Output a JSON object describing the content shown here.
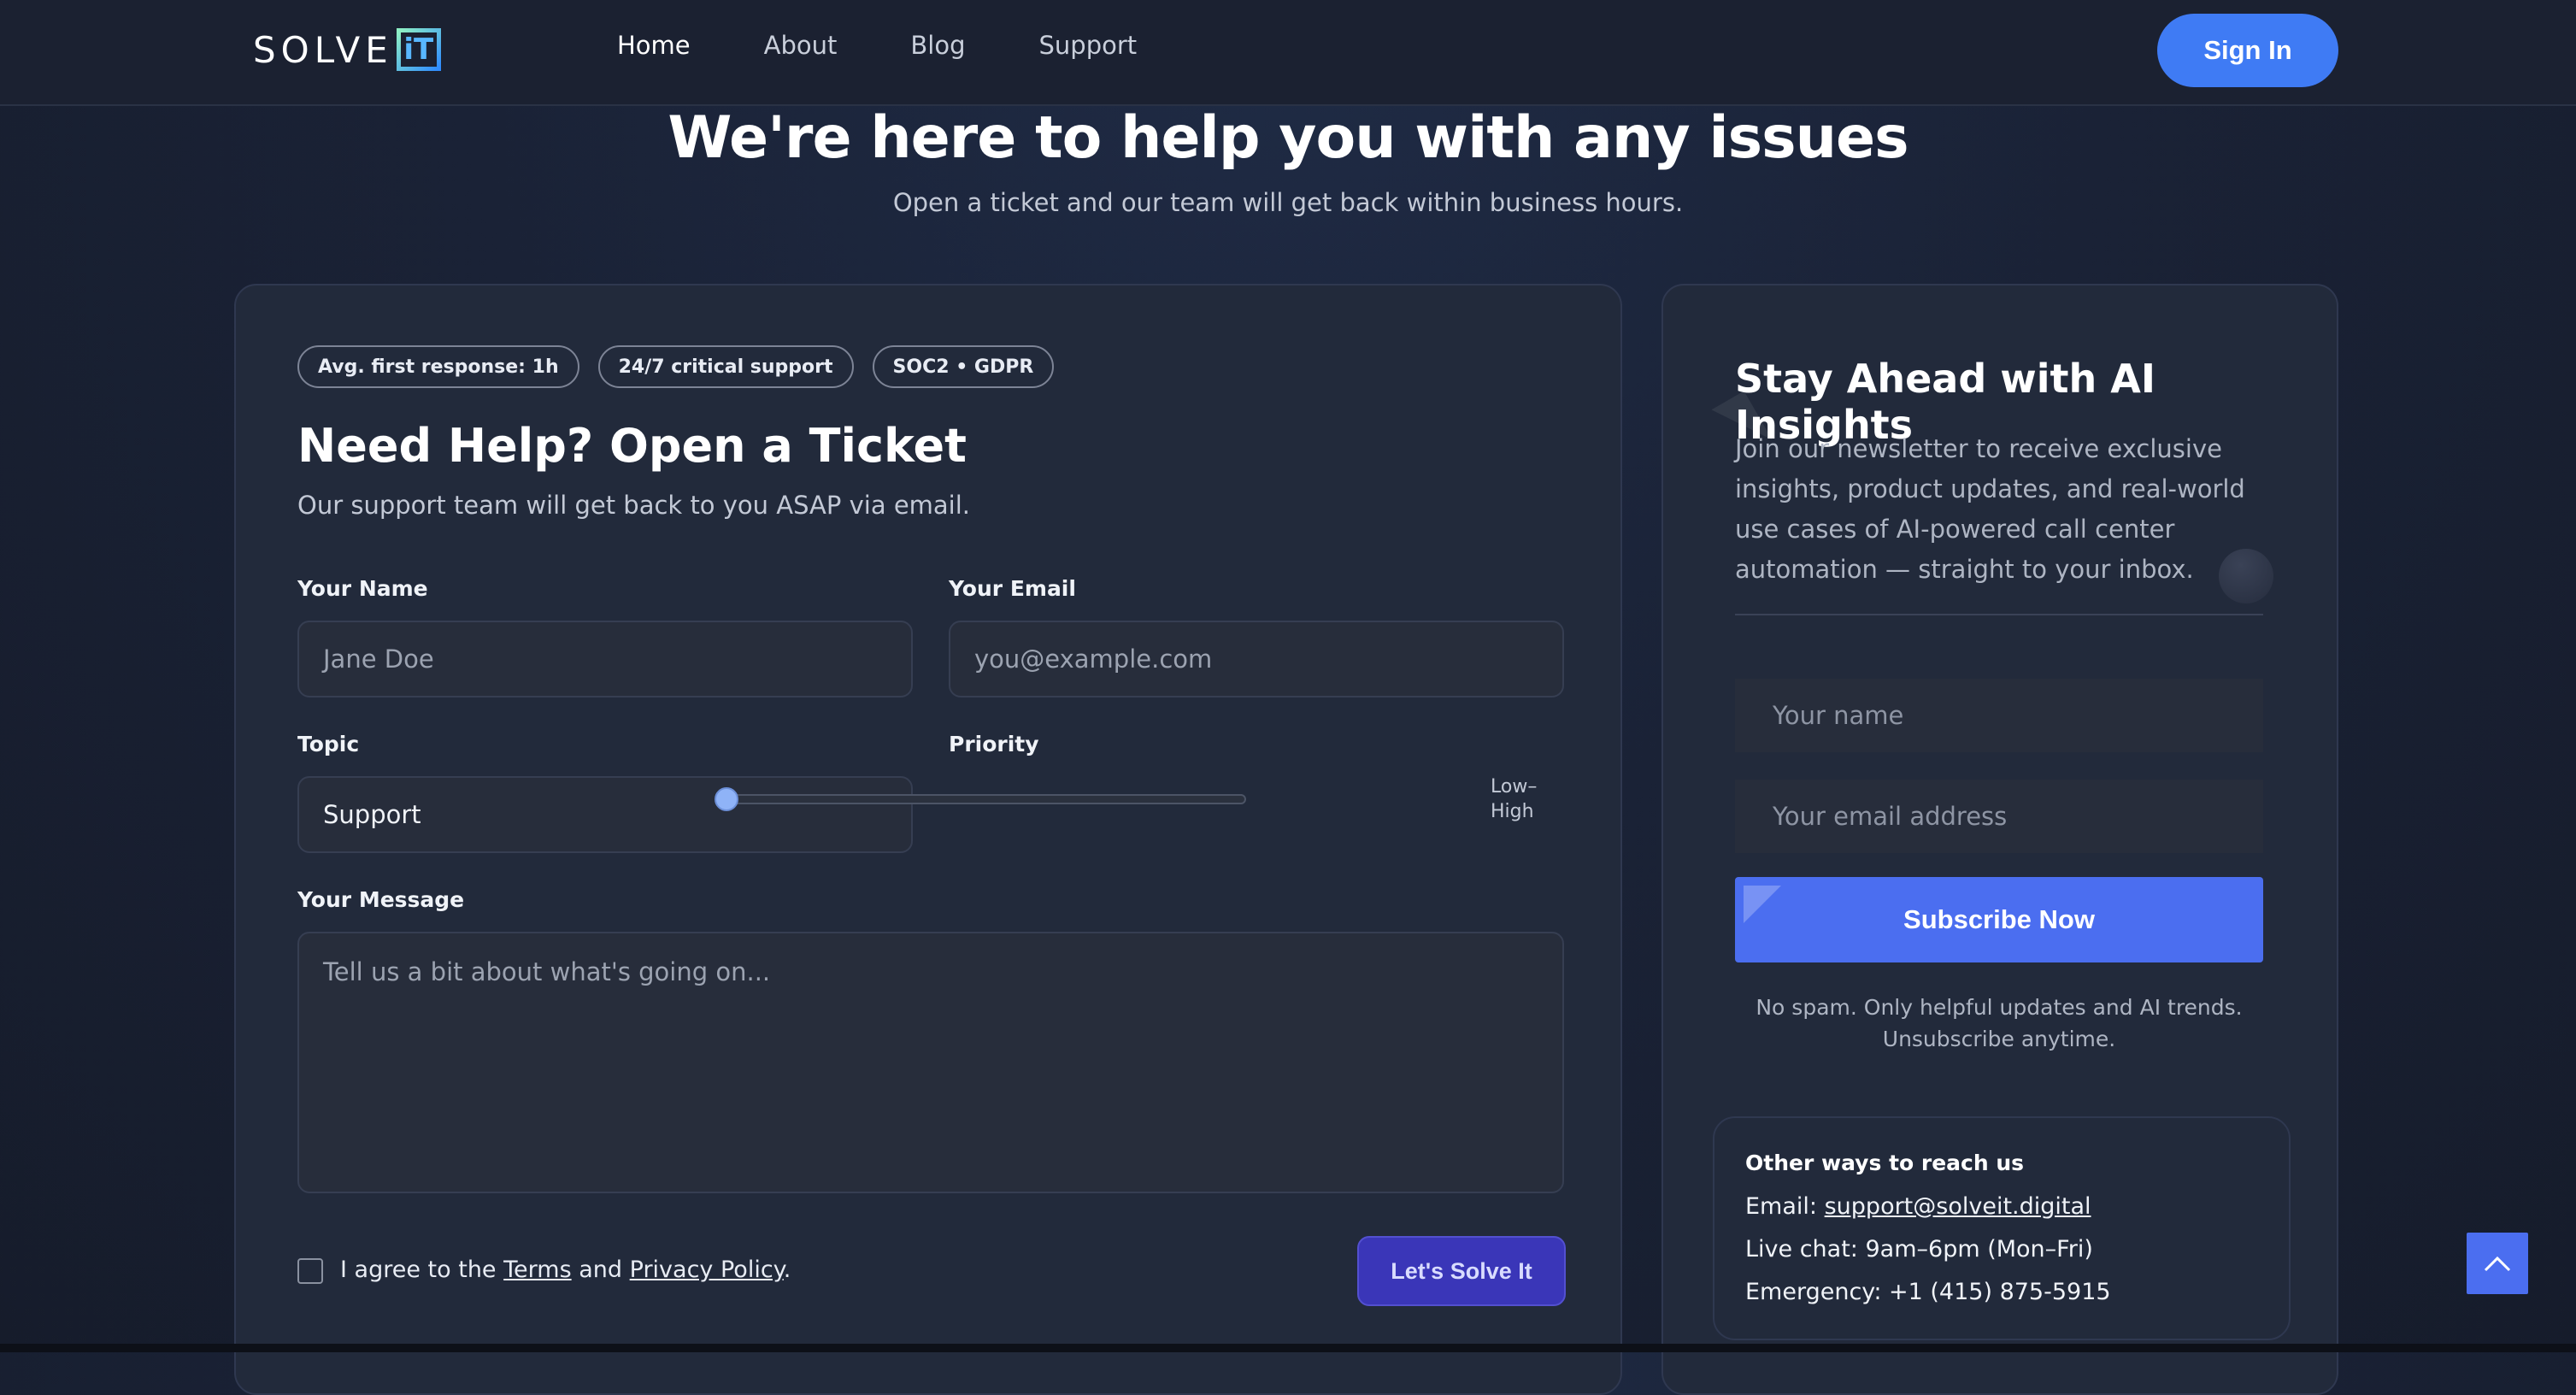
{
  "nav": {
    "logo_text": "SOLVE",
    "logo_box": "iT",
    "links": [
      "Home",
      "About",
      "Blog",
      "Support"
    ],
    "signin_label": "Sign In"
  },
  "hero": {
    "title": "We're here to help you with any issues",
    "subtitle": "Open a ticket and our team will get back within business hours."
  },
  "ticket": {
    "badges": [
      "Avg. first response: 1h",
      "24/7 critical support",
      "SOC2 • GDPR"
    ],
    "title": "Need Help? Open a Ticket",
    "subtitle": "Our support team will get back to you ASAP via email.",
    "name_label": "Your Name",
    "name_placeholder": "Jane Doe",
    "email_label": "Your Email",
    "email_placeholder": "you@example.com",
    "topic_label": "Topic",
    "topic_value": "Support",
    "priority_label": "Priority",
    "priority_range_low": "Low–",
    "priority_range_high": "High",
    "priority_value": 0,
    "message_label": "Your Message",
    "message_placeholder": "Tell us a bit about what's going on...",
    "agree_prefix": "I agree to the",
    "terms_link": "Terms",
    "agree_and": "and",
    "privacy_link": "Privacy Policy",
    "agree_suffix": ".",
    "submit_label": "Let's Solve It"
  },
  "newsletter": {
    "title": "Stay Ahead with AI Insights",
    "text": "Join our newsletter to receive exclusive insights, product updates, and real-world use cases of AI-powered call center automation — straight to your inbox.",
    "name_placeholder": "Your name",
    "email_placeholder": "Your email address",
    "subscribe_label": "Subscribe Now",
    "note": "No spam. Only helpful updates and AI trends. Unsubscribe anytime."
  },
  "reach": {
    "title": "Other ways to reach us",
    "email_prefix": "Email:",
    "email": "support@solveit.digital",
    "live_chat": "Live chat: 9am–6pm (Mon–Fri)",
    "emergency": "Emergency: +1 (415) 875-5915"
  },
  "colors": {
    "accent": "#3f7bf4",
    "subscribe": "#4b6ef0",
    "submit": "#3a36b8",
    "background": "#1a2236"
  }
}
